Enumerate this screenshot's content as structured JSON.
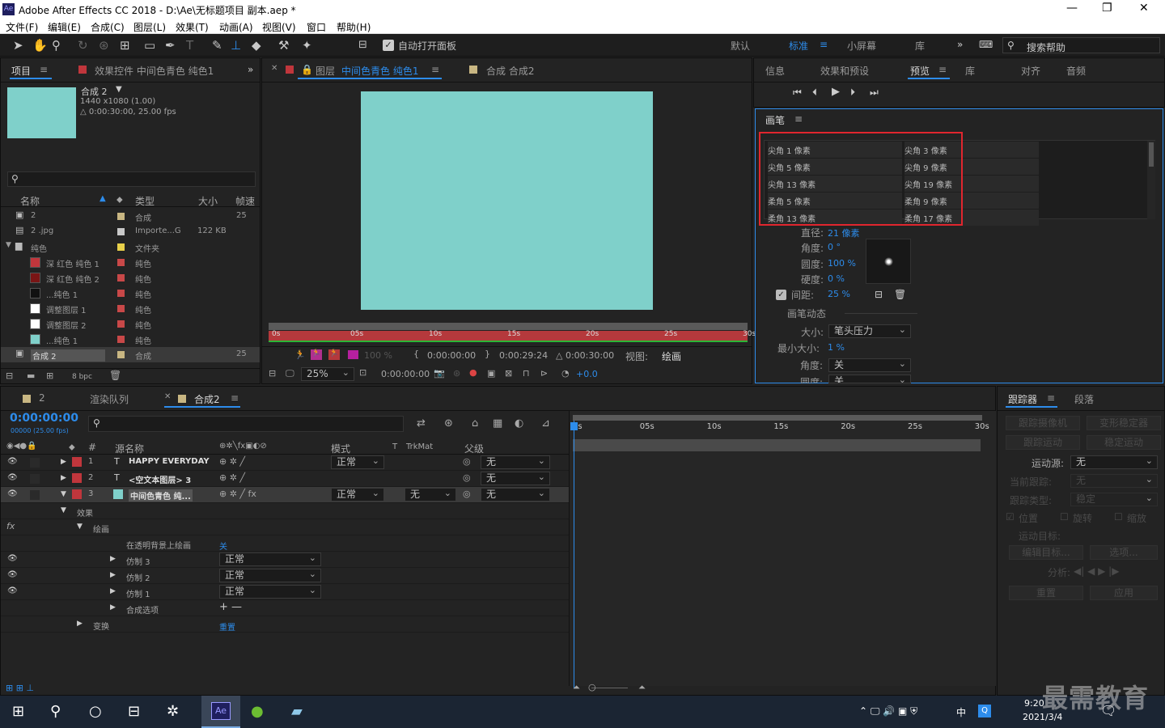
{
  "app": {
    "title": "Adobe After Effects CC 2018 - D:\\Ae\\无标题项目 副本.aep *",
    "icon_text": "Ae"
  },
  "window_controls": {
    "min": "—",
    "max": "❐",
    "close": "✕"
  },
  "menu": [
    "文件(F)",
    "编辑(E)",
    "合成(C)",
    "图层(L)",
    "效果(T)",
    "动画(A)",
    "视图(V)",
    "窗口",
    "帮助(H)"
  ],
  "toolbar": {
    "auto_open": "自动打开面板",
    "workspaces": [
      "默认",
      "标准",
      "小屏幕",
      "库"
    ],
    "active_ws": "标准",
    "search": "搜索帮助"
  },
  "project": {
    "tabs": [
      "项目",
      "效果控件 中间色青色 纯色1"
    ],
    "comp_name": "合成 2",
    "comp_res": "1440 x1080 (1.00)",
    "comp_dur": "△ 0:00:30:00, 25.00 fps",
    "cols": [
      "名称",
      "类型",
      "大小",
      "帧速"
    ],
    "items": [
      {
        "name": "2",
        "type": "合成",
        "size": "",
        "fps": "25",
        "color": "#c8b682",
        "sw": ""
      },
      {
        "name": "2 .jpg",
        "type": "Importe...G",
        "size": "122 KB",
        "fps": "",
        "color": "#c8c8c8",
        "sw": ""
      },
      {
        "name": "纯色",
        "type": "文件夹",
        "size": "",
        "fps": "",
        "color": "#e8d04a",
        "sw": ""
      },
      {
        "name": "深 红色 纯色 1",
        "type": "纯色",
        "size": "",
        "fps": "",
        "color": "#c84848",
        "sw": "#c0363c"
      },
      {
        "name": "深 红色 纯色 2",
        "type": "纯色",
        "size": "",
        "fps": "",
        "color": "#c84848",
        "sw": "#7a1515"
      },
      {
        "name": "...纯色 1",
        "type": "纯色",
        "size": "",
        "fps": "",
        "color": "#c84848",
        "sw": "#111111"
      },
      {
        "name": "调整图层 1",
        "type": "纯色",
        "size": "",
        "fps": "",
        "color": "#c84848",
        "sw": "#ffffff"
      },
      {
        "name": "调整图层 2",
        "type": "纯色",
        "size": "",
        "fps": "",
        "color": "#c84848",
        "sw": "#ffffff"
      },
      {
        "name": "...纯色 1",
        "type": "纯色",
        "size": "",
        "fps": "",
        "color": "#c84848",
        "sw": "#7fd0ca"
      },
      {
        "name": "合成 2",
        "type": "合成",
        "size": "",
        "fps": "25",
        "color": "#c8b682",
        "sw": ""
      }
    ],
    "bpc": "8 bpc"
  },
  "viewer": {
    "tab1_prefix": "图层",
    "tab1_name": "中间色青色 纯色1",
    "tab2": "合成 合成2",
    "ruler": [
      "0s",
      "05s",
      "10s",
      "15s",
      "20s",
      "25s",
      "30s"
    ],
    "tc_in": "0:00:00:00",
    "tc_out": "0:00:29:24",
    "tc_dur": "△ 0:00:30:00",
    "view_label": "视图:",
    "view_val": "绘画",
    "zoom": "25%",
    "tc": "0:00:00:00",
    "exposure": "+0.0",
    "opacity": "100 %",
    "solid_color": "#7fd0ca"
  },
  "right": {
    "tabs": [
      "信息",
      "效果和预设",
      "预览",
      "库",
      "对齐",
      "音频"
    ]
  },
  "brush": {
    "title": "画笔",
    "cells": [
      [
        "尖角 1 像素",
        "尖角 3 像素"
      ],
      [
        "尖角 5 像素",
        "尖角 9 像素"
      ],
      [
        "尖角 13 像素",
        "尖角 19 像素"
      ],
      [
        "柔角 5 像素",
        "柔角 9 像素"
      ],
      [
        "柔角 13 像素",
        "柔角 17 像素"
      ]
    ],
    "props": [
      {
        "label": "直径:",
        "value": "21 像素"
      },
      {
        "label": "角度:",
        "value": "0 °"
      },
      {
        "label": "圆度:",
        "value": "100 %"
      },
      {
        "label": "硬度:",
        "value": "0 %"
      },
      {
        "label": "间距:",
        "value": "25 %"
      }
    ],
    "dynamics": "画笔动态",
    "size_label": "大小:",
    "size_val": "笔头压力",
    "min_label": "最小大小:",
    "min_val": "1 %",
    "angle_label": "角度:",
    "angle_val": "关",
    "round_label": "圆度:",
    "round_val": "关"
  },
  "timeline": {
    "tabs": [
      "2",
      "渲染队列",
      "合成2"
    ],
    "timecode": "0:00:00:00",
    "fps": "00000 (25.00 fps)",
    "cols": [
      "源名称",
      "模式",
      "T",
      "TrkMat",
      "父级"
    ],
    "ruler": [
      "0s",
      "05s",
      "10s",
      "15s",
      "20s",
      "25s",
      "30s"
    ],
    "layers": [
      {
        "num": "1",
        "type": "T",
        "name": "HAPPY EVERYDAY",
        "mode": "正常",
        "trk": "",
        "parent": "无"
      },
      {
        "num": "2",
        "type": "T",
        "name": "<空文本图层> 3",
        "mode": "",
        "trk": "",
        "parent": "无"
      },
      {
        "num": "3",
        "type": "",
        "name": "中间色青色 纯...",
        "mode": "正常",
        "trk": "无",
        "parent": "无"
      }
    ],
    "effects": "效果",
    "paint": "绘画",
    "onTrans": "在透明背景上绘画",
    "onTransVal": "关",
    "clones": [
      {
        "name": "仿制 3",
        "mode": "正常"
      },
      {
        "name": "仿制 2",
        "mode": "正常"
      },
      {
        "name": "仿制 1",
        "mode": "正常"
      }
    ],
    "compOpt": "合成选项",
    "compOptVal": "+ —",
    "transform": "变换",
    "reset": "重置"
  },
  "tracker": {
    "tabs": [
      "跟踪器",
      "段落"
    ],
    "btns": [
      "跟踪摄像机",
      "变形稳定器",
      "跟踪运动",
      "稳定运动"
    ],
    "source_label": "运动源:",
    "source_val": "无",
    "cur_label": "当前跟踪:",
    "cur_val": "无",
    "type_label": "跟踪类型:",
    "type_val": "稳定",
    "chk": [
      "位置",
      "旋转",
      "缩放"
    ],
    "target": "运动目标:",
    "edit": "编辑目标...",
    "opt": "选项...",
    "analyze": "分析:",
    "reset": "重置",
    "apply": "应用"
  },
  "taskbar": {
    "time": "9:20",
    "date": "2021/3/4",
    "ime": "中",
    "ae": "Ae"
  },
  "watermark": "最需教育"
}
